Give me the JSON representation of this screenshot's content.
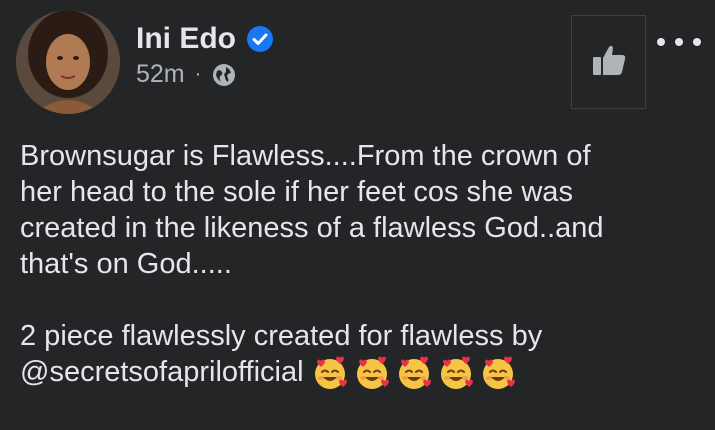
{
  "post": {
    "author": {
      "name": "Ini Edo",
      "verified": true
    },
    "timestamp": "52m",
    "separator": "·",
    "audience_icon": "globe-icon",
    "actions": {
      "like_icon": "thumbs-up-icon",
      "more_icon": "more-options-icon"
    },
    "text": {
      "line1": "Brownsugar is Flawless....From the crown of",
      "line2": "her head to the sole if her feet cos she was",
      "line3": "created in the likeness of a flawless God..and",
      "line4": "that's on God.....",
      "line5": "2 piece flawlessly created for flawless by",
      "handle": "@secretsofaprilofficial"
    },
    "emoji": {
      "name": "smiling-face-with-hearts",
      "count": 5
    },
    "colors": {
      "background": "#242526",
      "text": "#e4e6eb",
      "secondary": "#b0b3b8",
      "verified_blue": "#1877f2"
    }
  }
}
